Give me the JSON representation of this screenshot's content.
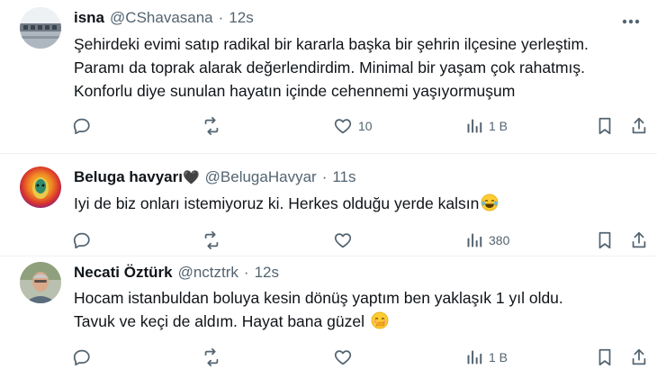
{
  "posts": [
    {
      "name": "isna",
      "handle": "@CShavasana",
      "separator": "·",
      "time": "12s",
      "lines": [
        "Şehirdeki evimi satıp radikal bir kararla başka bir şehrin ilçesine yerleştim.",
        "Paramı da toprak alarak değerlendirdim. Minimal bir yaşam çok rahatmış.",
        "Konforlu diye sunulan hayatın içinde cehennemi yaşıyormuşum"
      ],
      "likes": "10",
      "views": "1 B"
    },
    {
      "name": "Beluga havyarı",
      "name_badge": "🖤",
      "handle": "@BelugaHavyar",
      "separator": "·",
      "time": "11s",
      "lines": [
        "Iyi de biz onları istemiyoruz ki. Herkes olduğu yerde kalsın"
      ],
      "emoji": "laughing-tears-emoji",
      "likes": "",
      "views": "380"
    },
    {
      "name": "Necati Öztürk",
      "handle": "@nctztrk",
      "separator": "·",
      "time": "12s",
      "lines": [
        "Hocam istanbuldan boluya kesin dönüş yaptım ben yaklaşık 1 yıl oldu.",
        "Tavuk ve keçi de aldım.  Hayat bana güzel"
      ],
      "emoji": "hand-over-mouth-emoji",
      "likes": "",
      "views": "1 B"
    }
  ],
  "icons": {
    "reply": "reply-icon",
    "repost": "repost-icon",
    "like": "heart-icon",
    "views": "analytics-icon",
    "bookmark": "bookmark-icon",
    "share": "share-icon",
    "more": "more-icon"
  },
  "colors": {
    "text": "#0f1419",
    "secondary": "#536471",
    "divider": "#eff3f4"
  }
}
